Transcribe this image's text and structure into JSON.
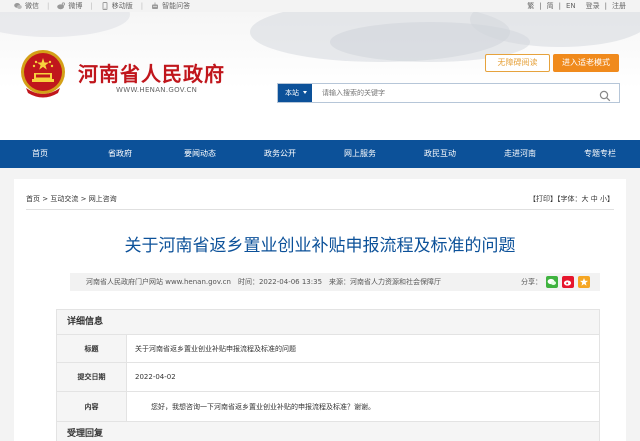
{
  "topbar": {
    "links": [
      {
        "icon": "weixin-icon",
        "label": "微信"
      },
      {
        "icon": "weibo-icon",
        "label": "微博"
      },
      {
        "icon": "mobile-icon",
        "label": "移动版"
      },
      {
        "icon": "robot-icon",
        "label": "智能问答"
      }
    ],
    "lang_traditional": "繁",
    "lang_simplified": "简",
    "lang_en": "EN",
    "login": "登录",
    "register": "注册",
    "sep": "|"
  },
  "header": {
    "site_title": "河南省人民政府",
    "site_url": "WWW.HENAN.GOV.CN",
    "btn_accessible": "无障碍阅读",
    "btn_elder": "进入适老模式",
    "search_scope": "本站",
    "search_placeholder": "请输入搜索的关键字"
  },
  "nav": [
    "首页",
    "省政府",
    "要闻动态",
    "政务公开",
    "网上服务",
    "政民互动",
    "走进河南",
    "专题专栏"
  ],
  "breadcrumb": {
    "items": [
      "首页",
      "互动交流",
      "网上咨询"
    ],
    "sep": ">"
  },
  "tools": {
    "print": "【打印】",
    "font_label": "【字体：",
    "font_large": "大",
    "font_medium": "中",
    "font_small": "小",
    "font_end": "】"
  },
  "article": {
    "title": "关于河南省返乡置业创业补贴申报流程及标准的问题",
    "meta": "河南省人民政府门户网站 www.henan.gov.cn　时间：2022-04-06 13:35　来源：河南省人力资源和社会保障厅",
    "share_label": "分享：",
    "share_icons": [
      "wechat-share-icon",
      "weibo-share-icon",
      "favorite-share-icon"
    ]
  },
  "detail": {
    "section_title": "详细信息",
    "rows": [
      {
        "label": "标题",
        "value": "关于河南省返乡置业创业补贴申报流程及标准的问题"
      },
      {
        "label": "提交日期",
        "value": "2022-04-02"
      },
      {
        "label": "内容",
        "value": "您好，我想咨询一下河南省返乡置业创业补贴的申报流程及标准？谢谢。"
      }
    ],
    "reply_title": "受理回复"
  },
  "colors": {
    "brand_blue": "#0c5199",
    "title_red": "#c0161c",
    "accent_orange": "#f08a1c"
  }
}
